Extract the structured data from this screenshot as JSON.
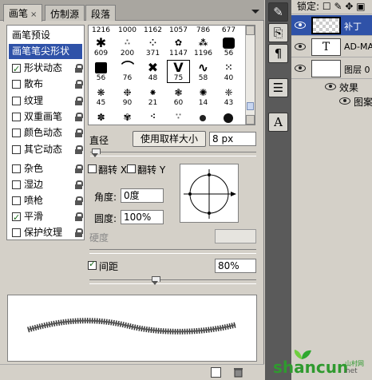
{
  "tabs": [
    {
      "label": "画笔",
      "close": "×"
    },
    {
      "label": "仿制源"
    },
    {
      "label": "段落"
    }
  ],
  "options": [
    {
      "label": "画笔预设",
      "header": true
    },
    {
      "label": "画笔笔尖形状",
      "header": true,
      "selected": true
    },
    {
      "label": "形状动态",
      "checked": true,
      "lock": true
    },
    {
      "label": "散布",
      "checked": false,
      "lock": true
    },
    {
      "label": "纹理",
      "checked": false,
      "lock": true
    },
    {
      "label": "双重画笔",
      "checked": false,
      "lock": true
    },
    {
      "label": "颜色动态",
      "checked": false,
      "lock": true
    },
    {
      "label": "其它动态",
      "checked": false,
      "lock": true
    },
    {
      "label": "杂色",
      "checked": false,
      "lock": true
    },
    {
      "label": "湿边",
      "checked": false,
      "lock": true
    },
    {
      "label": "喷枪",
      "checked": false,
      "lock": true
    },
    {
      "label": "平滑",
      "checked": true,
      "lock": true
    },
    {
      "label": "保护纹理",
      "checked": false,
      "lock": true
    }
  ],
  "brush_tips": {
    "row0": [
      "1216",
      "1000",
      "1162",
      "1057",
      "786",
      "677"
    ],
    "row1": [
      "609",
      "200",
      "371",
      "1147",
      "1196",
      "56"
    ],
    "row2": [
      "56",
      "76",
      "48",
      "75",
      "58",
      "40"
    ],
    "row3": [
      "45",
      "90",
      "21",
      "60",
      "14",
      "43"
    ],
    "selected_index": 9
  },
  "diameter": {
    "label": "直径",
    "button": "使用取样大小",
    "value": "8 px"
  },
  "flip": {
    "x_label": "翻转 X",
    "y_label": "翻转 Y"
  },
  "angle": {
    "label": "角度:",
    "value": "0度"
  },
  "roundness": {
    "label": "圆度:",
    "value": "100%"
  },
  "hardness": {
    "label": "硬度",
    "value": ""
  },
  "spacing": {
    "label": "间距",
    "checked": true,
    "value": "80%"
  },
  "layers_panel": {
    "lock_label": "锁定:",
    "layers": [
      {
        "name": "补丁",
        "thumb": "checker",
        "selected": true
      },
      {
        "name": "AD-MAG",
        "thumb": "T",
        "selected": false
      },
      {
        "name": "图层 0",
        "thumb": "white",
        "selected": false
      }
    ],
    "effects_label": "效果",
    "effect_item": "图案"
  },
  "dock_icons": [
    "brush-tool-icon",
    "clone-source-icon",
    "paragraph-icon",
    "layers-icon",
    "character-icon"
  ],
  "watermark": {
    "main": "shancun",
    "suffix": ".net",
    "sub": "山村网"
  },
  "colors": {
    "selection": "#2f52a8",
    "panel": "#d4d0c8",
    "dock": "#5a5a5a",
    "watermark_green": "#2fa82f"
  }
}
